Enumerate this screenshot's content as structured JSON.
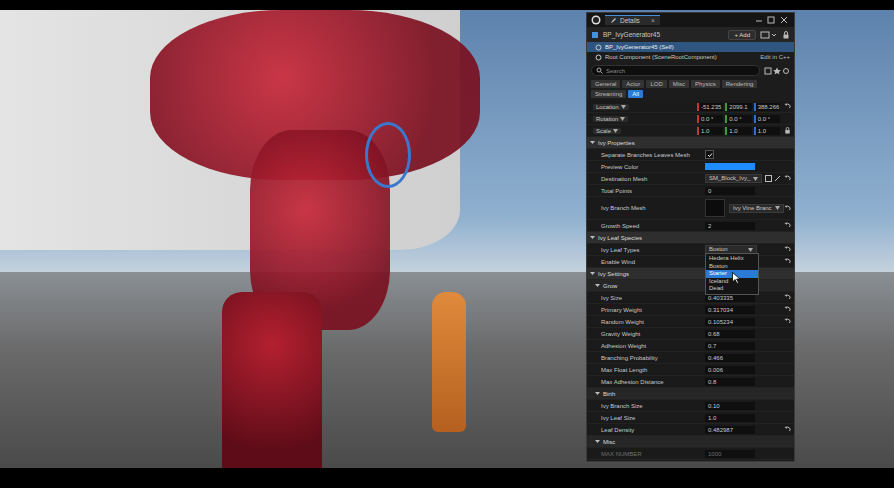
{
  "window": {
    "title": "Details",
    "close": "×"
  },
  "header": {
    "actor": "BP_IvyGenerator45",
    "add": "+ Add"
  },
  "components": [
    {
      "label": "BP_IvyGenerator45 (Self)",
      "selected": true,
      "action": ""
    },
    {
      "label": "Root Component (SceneRootComponent)",
      "selected": false,
      "action": "Edit in C++"
    }
  ],
  "search": {
    "placeholder": "Search"
  },
  "filters": [
    {
      "label": "General",
      "selected": false
    },
    {
      "label": "Actor",
      "selected": false
    },
    {
      "label": "LOD",
      "selected": false
    },
    {
      "label": "Misc",
      "selected": false
    },
    {
      "label": "Physics",
      "selected": false
    },
    {
      "label": "Rendering",
      "selected": false
    },
    {
      "label": "Streaming",
      "selected": false
    },
    {
      "label": "All",
      "selected": true
    }
  ],
  "transform": [
    {
      "label": "Location",
      "values": [
        "-51.235",
        "2099.1",
        "388.266"
      ],
      "reset": true,
      "locked": false
    },
    {
      "label": "Rotation",
      "values": [
        "0.0 °",
        "0.0 °",
        "0.0 °"
      ],
      "reset": false,
      "locked": false
    },
    {
      "label": "Scale",
      "values": [
        "1.0",
        "1.0",
        "1.0"
      ],
      "reset": false,
      "locked": true
    }
  ],
  "sections": [
    {
      "title": "Ivy Properties",
      "kind": "category",
      "expanded": true,
      "rows": [
        {
          "kind": "check",
          "label": "Separate Branches Leaves Mesh",
          "checked": true,
          "reset": false,
          "disabled": false
        },
        {
          "kind": "color",
          "label": "Preview Color",
          "color": "#1e8cff",
          "reset": false,
          "disabled": false
        },
        {
          "kind": "asset",
          "label": "Destination Mesh",
          "value": "SM_Block_Ivy_",
          "reset": true,
          "disabled": false
        },
        {
          "kind": "number",
          "label": "Total Points",
          "value": "0",
          "reset": false,
          "disabled": false
        },
        {
          "kind": "thumb",
          "label": "Ivy Branch Mesh",
          "value": "Ivy Vine Branc",
          "reset": true,
          "disabled": false
        },
        {
          "kind": "number",
          "label": "Growth Speed",
          "value": "2",
          "reset": true,
          "disabled": false
        }
      ]
    },
    {
      "title": "Ivy Leaf Species",
      "kind": "category",
      "expanded": true,
      "rows": [
        {
          "kind": "combo",
          "label": "Ivy Leaf Types",
          "value": "Boston",
          "open": true,
          "reset": true,
          "disabled": false,
          "options": [
            {
              "label": "Hedera Helix",
              "selected": false
            },
            {
              "label": "Boston",
              "selected": false
            },
            {
              "label": "Starter",
              "selected": true
            },
            {
              "label": "Iceland",
              "selected": false
            },
            {
              "label": "Dead",
              "selected": false
            }
          ]
        },
        {
          "kind": "plain",
          "label": "Enable Wind",
          "reset": true,
          "disabled": false
        }
      ]
    },
    {
      "title": "Ivy Settings",
      "kind": "category",
      "expanded": true,
      "rows": []
    },
    {
      "title": "Grow",
      "kind": "subcategory",
      "expanded": true,
      "rows": [
        {
          "kind": "number",
          "label": "Ivy Size",
          "value": "0.403335",
          "reset": true,
          "disabled": false
        },
        {
          "kind": "number",
          "label": "Primary Weight",
          "value": "0.317034",
          "reset": true,
          "disabled": false
        },
        {
          "kind": "number",
          "label": "Random Weight",
          "value": "0.105234",
          "reset": true,
          "disabled": false
        },
        {
          "kind": "number",
          "label": "Gravity Weight",
          "value": "0.68",
          "reset": false,
          "disabled": false
        },
        {
          "kind": "number",
          "label": "Adhesion Weight",
          "value": "0.7",
          "reset": false,
          "disabled": false
        },
        {
          "kind": "number",
          "label": "Branching Probability",
          "value": "0.466",
          "reset": false,
          "disabled": false
        },
        {
          "kind": "number",
          "label": "Max Float Length",
          "value": "0.006",
          "reset": false,
          "disabled": false
        },
        {
          "kind": "number",
          "label": "Max Adhesion Distance",
          "value": "0.8",
          "reset": false,
          "disabled": false
        }
      ]
    },
    {
      "title": "Birth",
      "kind": "subcategory",
      "expanded": true,
      "rows": [
        {
          "kind": "number",
          "label": "Ivy Branch Size",
          "value": "0.10",
          "reset": false,
          "disabled": false
        },
        {
          "kind": "number",
          "label": "Ivy Leaf Size",
          "value": "1.0",
          "reset": false,
          "disabled": false
        },
        {
          "kind": "number",
          "label": "Leaf Density",
          "value": "0.482987",
          "reset": true,
          "disabled": false
        }
      ]
    },
    {
      "title": "Misc",
      "kind": "subcategory",
      "expanded": true,
      "rows": [
        {
          "kind": "number",
          "label": "MAX NUMBER",
          "value": "1000",
          "reset": false,
          "disabled": true
        }
      ]
    }
  ]
}
